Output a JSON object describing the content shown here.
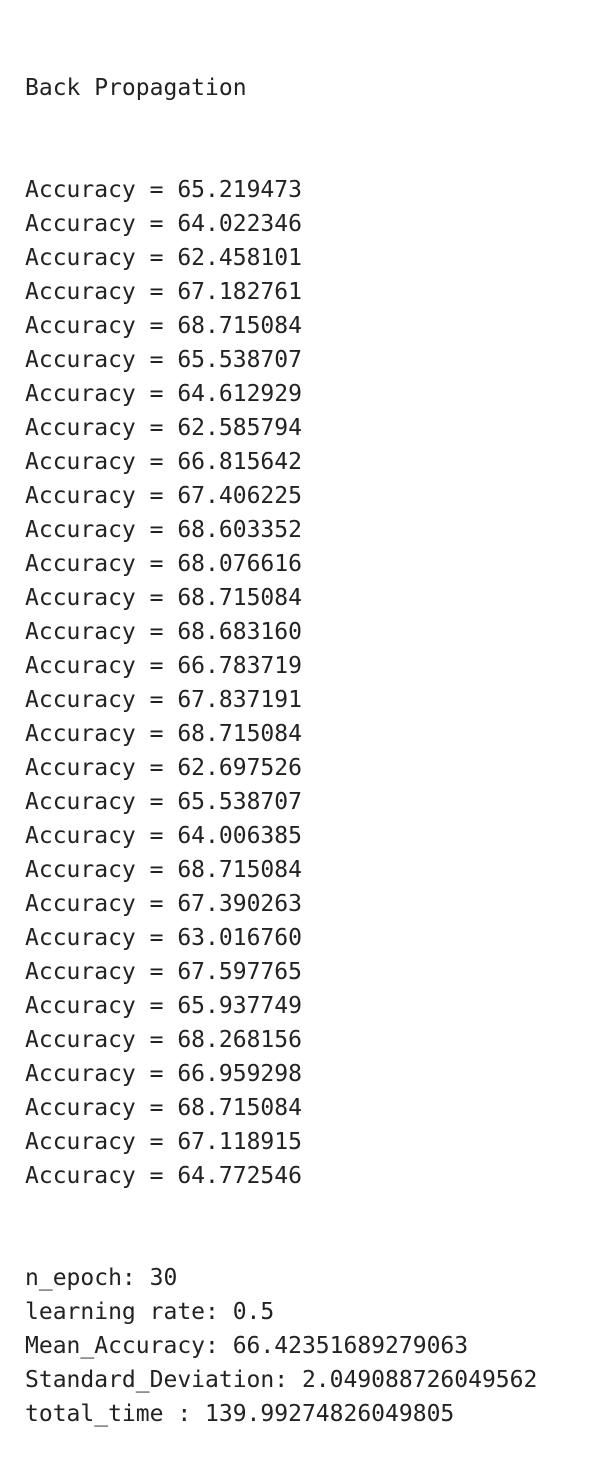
{
  "output": {
    "header": "Back Propagation",
    "accuracy_label": "Accuracy = ",
    "accuracies": [
      "65.219473",
      "64.022346",
      "62.458101",
      "67.182761",
      "68.715084",
      "65.538707",
      "64.612929",
      "62.585794",
      "66.815642",
      "67.406225",
      "68.603352",
      "68.076616",
      "68.715084",
      "68.683160",
      "66.783719",
      "67.837191",
      "68.715084",
      "62.697526",
      "65.538707",
      "64.006385",
      "68.715084",
      "67.390263",
      "63.016760",
      "67.597765",
      "65.937749",
      "68.268156",
      "66.959298",
      "68.715084",
      "67.118915",
      "64.772546"
    ],
    "summary": [
      "n_epoch: 30",
      "learning rate: 0.5",
      "Mean_Accuracy: 66.42351689279063",
      "Standard_Deviation: 2.049088726049562",
      "total_time : 139.99274826049805"
    ]
  }
}
